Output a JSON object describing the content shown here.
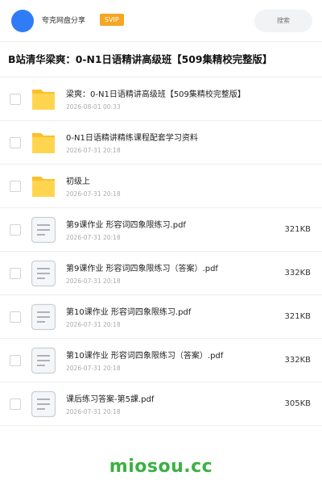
{
  "header": {
    "app_name": "夸克网盘分享",
    "badge": "SVIP",
    "search_placeholder": "搜索"
  },
  "page_title": "B站清华梁爽：0-N1日语精讲高级班【509集精校完整版】",
  "files": [
    {
      "type": "folder",
      "name": "梁爽：0-N1日语精讲高级班【509集精校完整版】",
      "date": "2026-08-01 00:33",
      "size": ""
    },
    {
      "type": "folder",
      "name": "0-N1日语精讲精练课程配套学习资料",
      "date": "2026-07-31 20:18",
      "size": ""
    },
    {
      "type": "folder",
      "name": "初级上",
      "date": "2026-07-31 20:18",
      "size": ""
    },
    {
      "type": "doc",
      "name": "第9课作业 形容词四象限练习.pdf",
      "date": "2026-07-31 20:18",
      "size": "321KB"
    },
    {
      "type": "doc",
      "name": "第9课作业 形容词四象限练习（答案）.pdf",
      "date": "2026-07-31 20:18",
      "size": "332KB"
    },
    {
      "type": "doc",
      "name": "第10课作业 形容词四象限练习.pdf",
      "date": "2026-07-31 20:18",
      "size": "321KB"
    },
    {
      "type": "doc",
      "name": "第10课作业 形容词四象限练习（答案）.pdf",
      "date": "2026-07-31 20:18",
      "size": "332KB"
    },
    {
      "type": "doc",
      "name": "课后练习答案-第5課.pdf",
      "date": "2026-07-31 20:18",
      "size": "305KB"
    }
  ],
  "watermark": "miosou.cc",
  "colors": {
    "avatar": "#2f7cf6",
    "badge": "#f5a623",
    "folder": "#fbc02d",
    "watermark": "#3cb043"
  }
}
